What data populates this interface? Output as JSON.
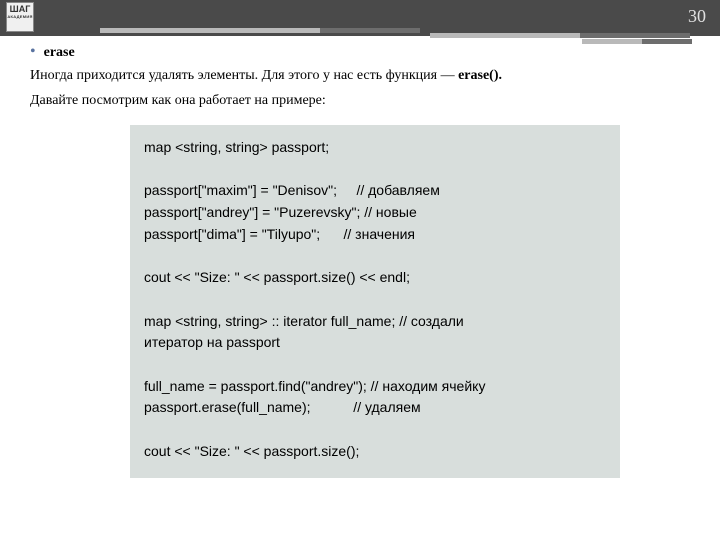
{
  "header": {
    "logo_main": "ШАГ",
    "logo_sub": "АКАДЕМИЯ",
    "page_number": "30"
  },
  "body": {
    "bullet_title": "erase",
    "para_1_prefix": "Иногда приходится удалять элементы. Для этого у нас есть функция — ",
    "para_1_bold": "erase().",
    "para_2": "Давайте посмотрим как она работает на примере:"
  },
  "code": {
    "l01": "map <string, string> passport;",
    "l02": "",
    "l03": "passport[\"maxim\"] = \"Denisov\";     // добавляем",
    "l04": "passport[\"andrey\"] = \"Puzerevsky\"; // новые",
    "l05": "passport[\"dima\"] = \"Tilyupo\";      // значения",
    "l06": "",
    "l07": "cout << \"Size: \" << passport.size() << endl;",
    "l08": "",
    "l09": "map <string, string> :: iterator full_name; // создали",
    "l10": "итератор на passport",
    "l11": "",
    "l12": "full_name = passport.find(\"andrey\"); // находим ячейку",
    "l13": "passport.erase(full_name);           // удаляем",
    "l14": "",
    "l15": "cout << \"Size: \" << passport.size();"
  }
}
